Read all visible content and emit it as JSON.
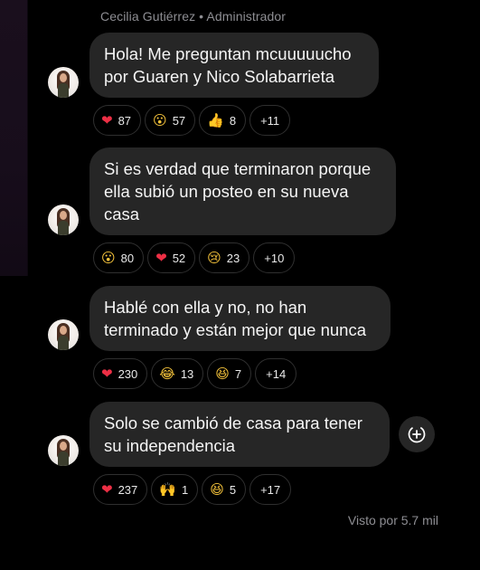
{
  "sender": {
    "name": "Cecilia Gutiérrez",
    "role": "Administrador",
    "separator": " • "
  },
  "messages": [
    {
      "text_lines": [
        "Hola! Me preguntan mcuuuuucho",
        "por Guaren y Nico Solabarrieta"
      ],
      "reactions": [
        {
          "emoji": "❤",
          "icon": "heart-icon",
          "count": "87"
        },
        {
          "emoji": "😮",
          "icon": "surprised-face-icon",
          "count": "57"
        },
        {
          "emoji": "👍",
          "icon": "thumbs-up-icon",
          "count": "8"
        }
      ],
      "more": "+11"
    },
    {
      "text_lines": [
        "Si es verdad que terminaron porque",
        "ella subió un posteo en su nueva",
        "casa"
      ],
      "reactions": [
        {
          "emoji": "😮",
          "icon": "surprised-face-icon",
          "count": "80"
        },
        {
          "emoji": "❤",
          "icon": "heart-icon",
          "count": "52"
        },
        {
          "emoji": "😢",
          "icon": "crying-face-icon",
          "count": "23"
        }
      ],
      "more": "+10"
    },
    {
      "text_lines": [
        "Hablé con ella y no, no han",
        "terminado y están mejor que nunca"
      ],
      "reactions": [
        {
          "emoji": "❤",
          "icon": "heart-icon",
          "count": "230"
        },
        {
          "emoji": "😂",
          "icon": "laughing-face-icon",
          "count": "13"
        },
        {
          "emoji": "😆",
          "icon": "grinning-squint-face-icon",
          "count": "7"
        }
      ],
      "more": "+14"
    },
    {
      "text_lines": [
        "Solo se cambió de casa para tener",
        "su independencia"
      ],
      "reactions": [
        {
          "emoji": "❤",
          "icon": "heart-icon",
          "count": "237"
        },
        {
          "emoji": "🙌",
          "icon": "raised-hands-icon",
          "count": "1"
        },
        {
          "emoji": "😆",
          "icon": "grinning-squint-face-icon",
          "count": "5"
        }
      ],
      "more": "+17"
    }
  ],
  "seen_text": "Visto por 5.7 mil",
  "colors": {
    "background": "#000000",
    "bubble": "#262626",
    "heart": "#ed2f45",
    "muted": "#8e8e93"
  }
}
